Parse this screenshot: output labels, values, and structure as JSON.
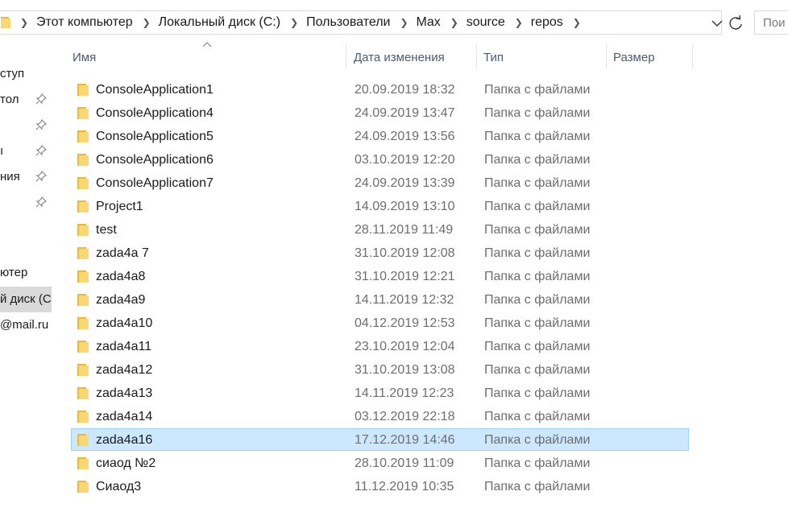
{
  "address_bar": {
    "breadcrumbs": [
      "Этот компьютер",
      "Локальный диск (C:)",
      "Пользователи",
      "Max",
      "source",
      "repos"
    ],
    "search_placeholder": "Пои"
  },
  "nav_pane": {
    "items": [
      {
        "label": "ступ",
        "pinned": false
      },
      {
        "label": "тол",
        "pinned": true
      },
      {
        "label": "",
        "pinned": true
      },
      {
        "label": "ı",
        "pinned": true
      },
      {
        "label": "ния",
        "pinned": true
      },
      {
        "label": "",
        "pinned": true
      },
      {
        "label": "ютер",
        "pinned": false
      },
      {
        "label": "й диск (С",
        "pinned": false,
        "selected": true
      },
      {
        "label": "@mail.ru",
        "pinned": false
      }
    ]
  },
  "columns": {
    "name": "Имя",
    "date": "Дата изменения",
    "type": "Тип",
    "size": "Размер"
  },
  "files": [
    {
      "name": "ConsoleApplication1",
      "date": "20.09.2019 18:32",
      "type": "Папка с файлами"
    },
    {
      "name": "ConsoleApplication4",
      "date": "24.09.2019 13:47",
      "type": "Папка с файлами"
    },
    {
      "name": "ConsoleApplication5",
      "date": "24.09.2019 13:56",
      "type": "Папка с файлами"
    },
    {
      "name": "ConsoleApplication6",
      "date": "03.10.2019 12:20",
      "type": "Папка с файлами"
    },
    {
      "name": "ConsoleApplication7",
      "date": "24.09.2019 13:39",
      "type": "Папка с файлами"
    },
    {
      "name": "Project1",
      "date": "14.09.2019 13:10",
      "type": "Папка с файлами"
    },
    {
      "name": "test",
      "date": "28.11.2019 11:49",
      "type": "Папка с файлами"
    },
    {
      "name": "zada4a 7",
      "date": "31.10.2019 12:08",
      "type": "Папка с файлами"
    },
    {
      "name": "zada4a8",
      "date": "31.10.2019 12:21",
      "type": "Папка с файлами"
    },
    {
      "name": "zada4a9",
      "date": "14.11.2019 12:32",
      "type": "Папка с файлами"
    },
    {
      "name": "zada4a10",
      "date": "04.12.2019 12:53",
      "type": "Папка с файлами"
    },
    {
      "name": "zada4a11",
      "date": "23.10.2019 12:04",
      "type": "Папка с файлами"
    },
    {
      "name": "zada4a12",
      "date": "31.10.2019 13:08",
      "type": "Папка с файлами"
    },
    {
      "name": "zada4a13",
      "date": "14.11.2019 12:23",
      "type": "Папка с файлами"
    },
    {
      "name": "zada4a14",
      "date": "03.12.2019 22:18",
      "type": "Папка с файлами"
    },
    {
      "name": "zada4a16",
      "date": "17.12.2019 14:46",
      "type": "Папка с файлами",
      "selected": true
    },
    {
      "name": "сиаод №2",
      "date": "28.10.2019 11:09",
      "type": "Папка с файлами"
    },
    {
      "name": "Сиаод3",
      "date": "11.12.2019 10:35",
      "type": "Папка с файлами"
    }
  ],
  "colors": {
    "selection_bg": "#cce8ff",
    "selection_border": "#99d1ff",
    "folder": "#f8d775",
    "header_text": "#4b5b73"
  },
  "icons": {
    "folder": "folder-icon",
    "pin": "pin-icon",
    "breadcrumb_separator": "chevron-right-icon",
    "dropdown": "chevron-down-icon",
    "refresh": "refresh-icon",
    "sort": "sort-up-icon"
  }
}
